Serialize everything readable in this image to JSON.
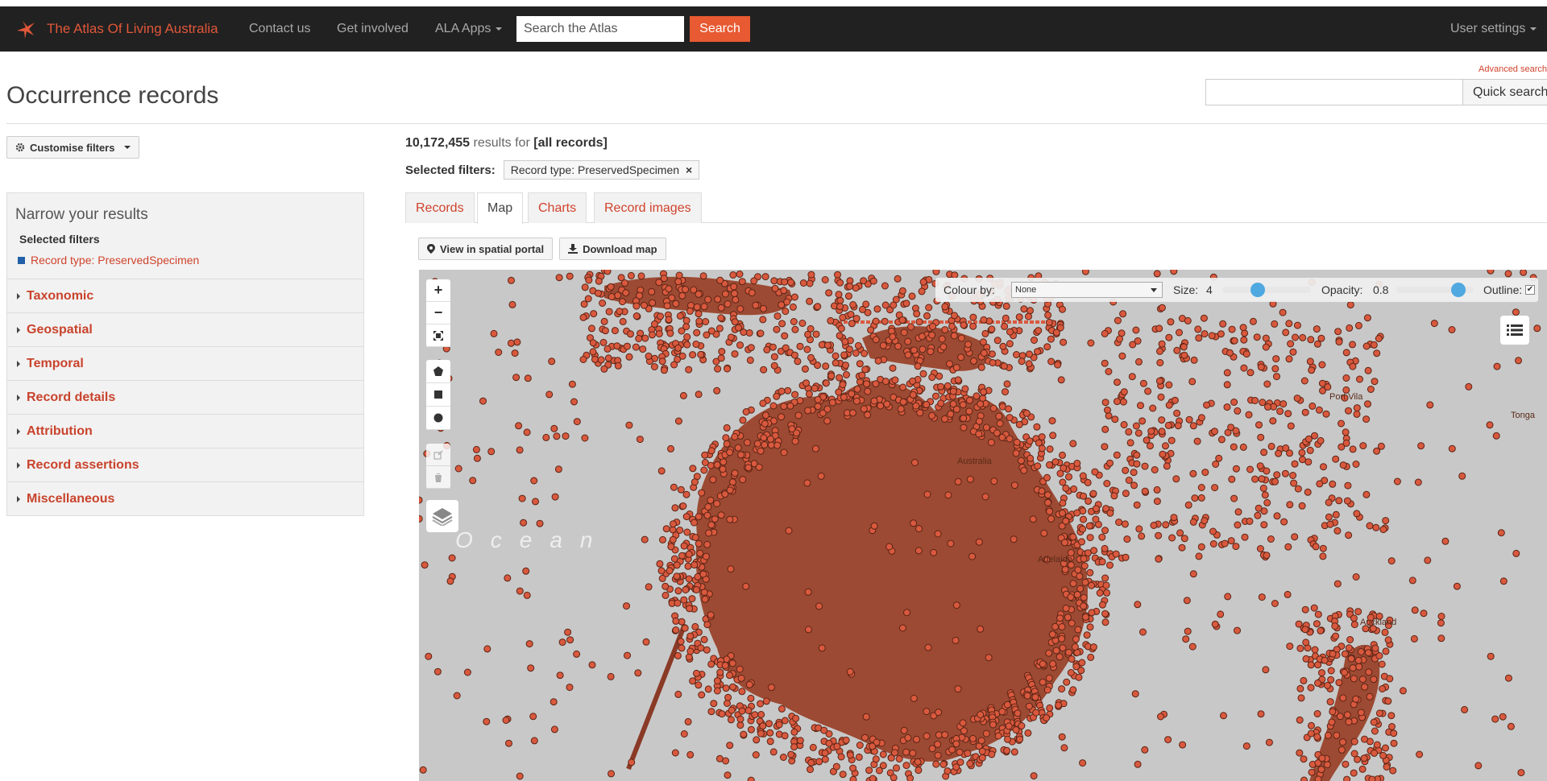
{
  "topnav": {
    "brand": "The Atlas Of Living Australia",
    "contact": "Contact us",
    "involved": "Get involved",
    "apps": "ALA Apps",
    "search_placeholder": "Search the Atlas",
    "search_btn": "Search",
    "user_settings": "User settings"
  },
  "header": {
    "title": "Occurrence records",
    "advanced": "Advanced search",
    "quick_search_btn": "Quick search"
  },
  "sidebar": {
    "customise": "Customise filters",
    "narrow_title": "Narrow your results",
    "selected_heading": "Selected filters",
    "selected_filter": "Record type: PreservedSpecimen",
    "facets": [
      "Taxonomic",
      "Geospatial",
      "Temporal",
      "Record details",
      "Attribution",
      "Record assertions",
      "Miscellaneous"
    ]
  },
  "results": {
    "count": "10,172,455",
    "label": "results for",
    "query": "[all records]",
    "filters_label": "Selected filters:",
    "filter_chip": "Record type: PreservedSpecimen",
    "chip_close": "×"
  },
  "tabs": [
    "Records",
    "Map",
    "Charts",
    "Record images"
  ],
  "active_tab": "Map",
  "map": {
    "view_spatial": "View in spatial portal",
    "download": "Download map",
    "colour_by_label": "Colour by:",
    "colour_by_value": "None",
    "size_label": "Size:",
    "size_value": "4",
    "opacity_label": "Opacity:",
    "opacity_value": "0.8",
    "outline_label": "Outline:",
    "outline_checked": "✔",
    "ocean_label": "Ocean",
    "places": [
      "Australia",
      "Adelaide",
      "Port Vila",
      "Tonga",
      "Auckland"
    ],
    "zoom_in": "+",
    "zoom_out": "−",
    "size_fraction": 0.4,
    "opacity_fraction": 0.8,
    "dot_color": "#d9593e"
  },
  "colors": {
    "brand": "#e0573a",
    "link": "#d0432c",
    "topbar": "#212121",
    "search_btn": "#e75a32"
  }
}
